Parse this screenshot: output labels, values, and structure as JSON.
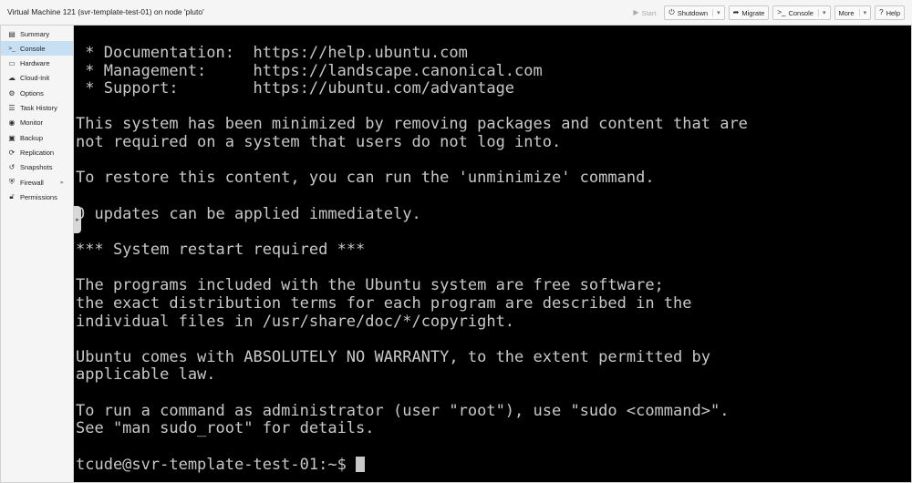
{
  "window": {
    "title": "Virtual Machine 121 (svr-template-test-01) on node 'pluto'"
  },
  "toolbar": {
    "start": {
      "label": "Start",
      "icon": "play-icon"
    },
    "shutdown": {
      "label": "Shutdown",
      "icon": "power-icon"
    },
    "migrate": {
      "label": "Migrate",
      "icon": "migrate-icon"
    },
    "console": {
      "label": "Console",
      "icon": "terminal-icon"
    },
    "more": {
      "label": "More"
    },
    "help": {
      "label": "Help",
      "icon": "help-icon"
    }
  },
  "sidebar": {
    "items": [
      {
        "label": "Summary",
        "icon": "summary-icon",
        "active": false
      },
      {
        "label": "Console",
        "icon": "terminal-icon",
        "active": true
      },
      {
        "label": "Hardware",
        "icon": "monitor-icon",
        "active": false
      },
      {
        "label": "Cloud-Init",
        "icon": "cloud-icon",
        "active": false
      },
      {
        "label": "Options",
        "icon": "gear-icon",
        "active": false
      },
      {
        "label": "Task History",
        "icon": "list-icon",
        "active": false
      },
      {
        "label": "Monitor",
        "icon": "eye-icon",
        "active": false
      },
      {
        "label": "Backup",
        "icon": "floppy-icon",
        "active": false
      },
      {
        "label": "Replication",
        "icon": "sync-icon",
        "active": false
      },
      {
        "label": "Snapshots",
        "icon": "history-icon",
        "active": false
      },
      {
        "label": "Firewall",
        "icon": "shield-icon",
        "active": false,
        "expandable": true
      },
      {
        "label": "Permissions",
        "icon": "unlock-icon",
        "active": false
      }
    ]
  },
  "console": {
    "lines": [
      " * Documentation:  https://help.ubuntu.com",
      " * Management:     https://landscape.canonical.com",
      " * Support:        https://ubuntu.com/advantage",
      "",
      "This system has been minimized by removing packages and content that are",
      "not required on a system that users do not log into.",
      "",
      "To restore this content, you can run the 'unminimize' command.",
      "",
      "0 updates can be applied immediately.",
      "",
      "*** System restart required ***",
      "",
      "The programs included with the Ubuntu system are free software;",
      "the exact distribution terms for each program are described in the",
      "individual files in /usr/share/doc/*/copyright.",
      "",
      "Ubuntu comes with ABSOLUTELY NO WARRANTY, to the extent permitted by",
      "applicable law.",
      "",
      "To run a command as administrator (user \"root\"), use \"sudo <command>\".",
      "See \"man sudo_root\" for details.",
      ""
    ],
    "prompt": "tcude@svr-template-test-01:~$ "
  }
}
